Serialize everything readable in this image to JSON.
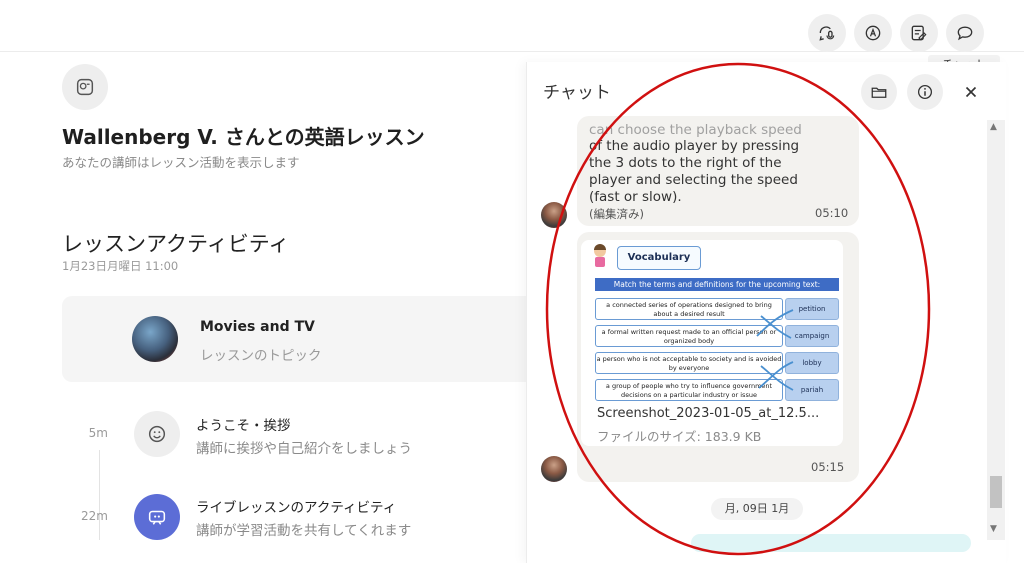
{
  "header": {
    "buttons": [
      {
        "name": "voice-chat-icon"
      },
      {
        "name": "translate-icon"
      },
      {
        "name": "notes-icon"
      },
      {
        "name": "chat-icon"
      }
    ],
    "tooltip": "チャット"
  },
  "lesson": {
    "title": "Wallenberg V. さんとの英語レッスン",
    "subtitle": "あなたの講師はレッスン活動を表示します"
  },
  "activity": {
    "title": "レッスンアクティビティ",
    "date": "1月23日月曜日 11:00",
    "topic": {
      "name": "Movies and TV",
      "label": "レッスンのトピック"
    },
    "steps": [
      {
        "duration": "5m",
        "title": "ようこそ・挨拶",
        "desc": "講師に挨拶や自己紹介をしましょう",
        "icon": "smile-icon"
      },
      {
        "duration": "22m",
        "title": "ライブレッスンのアクティビティ",
        "desc": "講師が学習活動を共有してくれます",
        "icon": "live-activity-icon"
      }
    ]
  },
  "chat": {
    "title": "チャット",
    "messages": [
      {
        "lines": [
          "can choose the playback speed",
          "of the audio player by pressing",
          "the 3 dots to the right of the",
          "player and selecting the speed",
          "(fast or slow)."
        ],
        "edited": "(編集済み)",
        "time": "05:10"
      },
      {
        "attachment": {
          "heading": "Vocabulary",
          "instruction": "Match the terms and definitions for the upcoming text:",
          "definitions": [
            "a connected series of operations designed to bring about a desired result",
            "a formal written request made to an official person or organized body",
            "a person who is not acceptable to society and is avoided by everyone",
            "a group of people who try to influence government decisions on a particular industry or issue"
          ],
          "terms": [
            "petition",
            "campaign",
            "lobby",
            "pariah"
          ],
          "file_name": "Screenshot_2023-01-05_at_12.5...",
          "file_size": "ファイルのサイズ: 183.9 KB"
        },
        "time": "05:15"
      }
    ],
    "date_divider": "月, 09日 1月"
  },
  "colors": {
    "accent": "#5c6dd6",
    "annotation": "#d01010",
    "bubble": "#f3f2ef"
  }
}
